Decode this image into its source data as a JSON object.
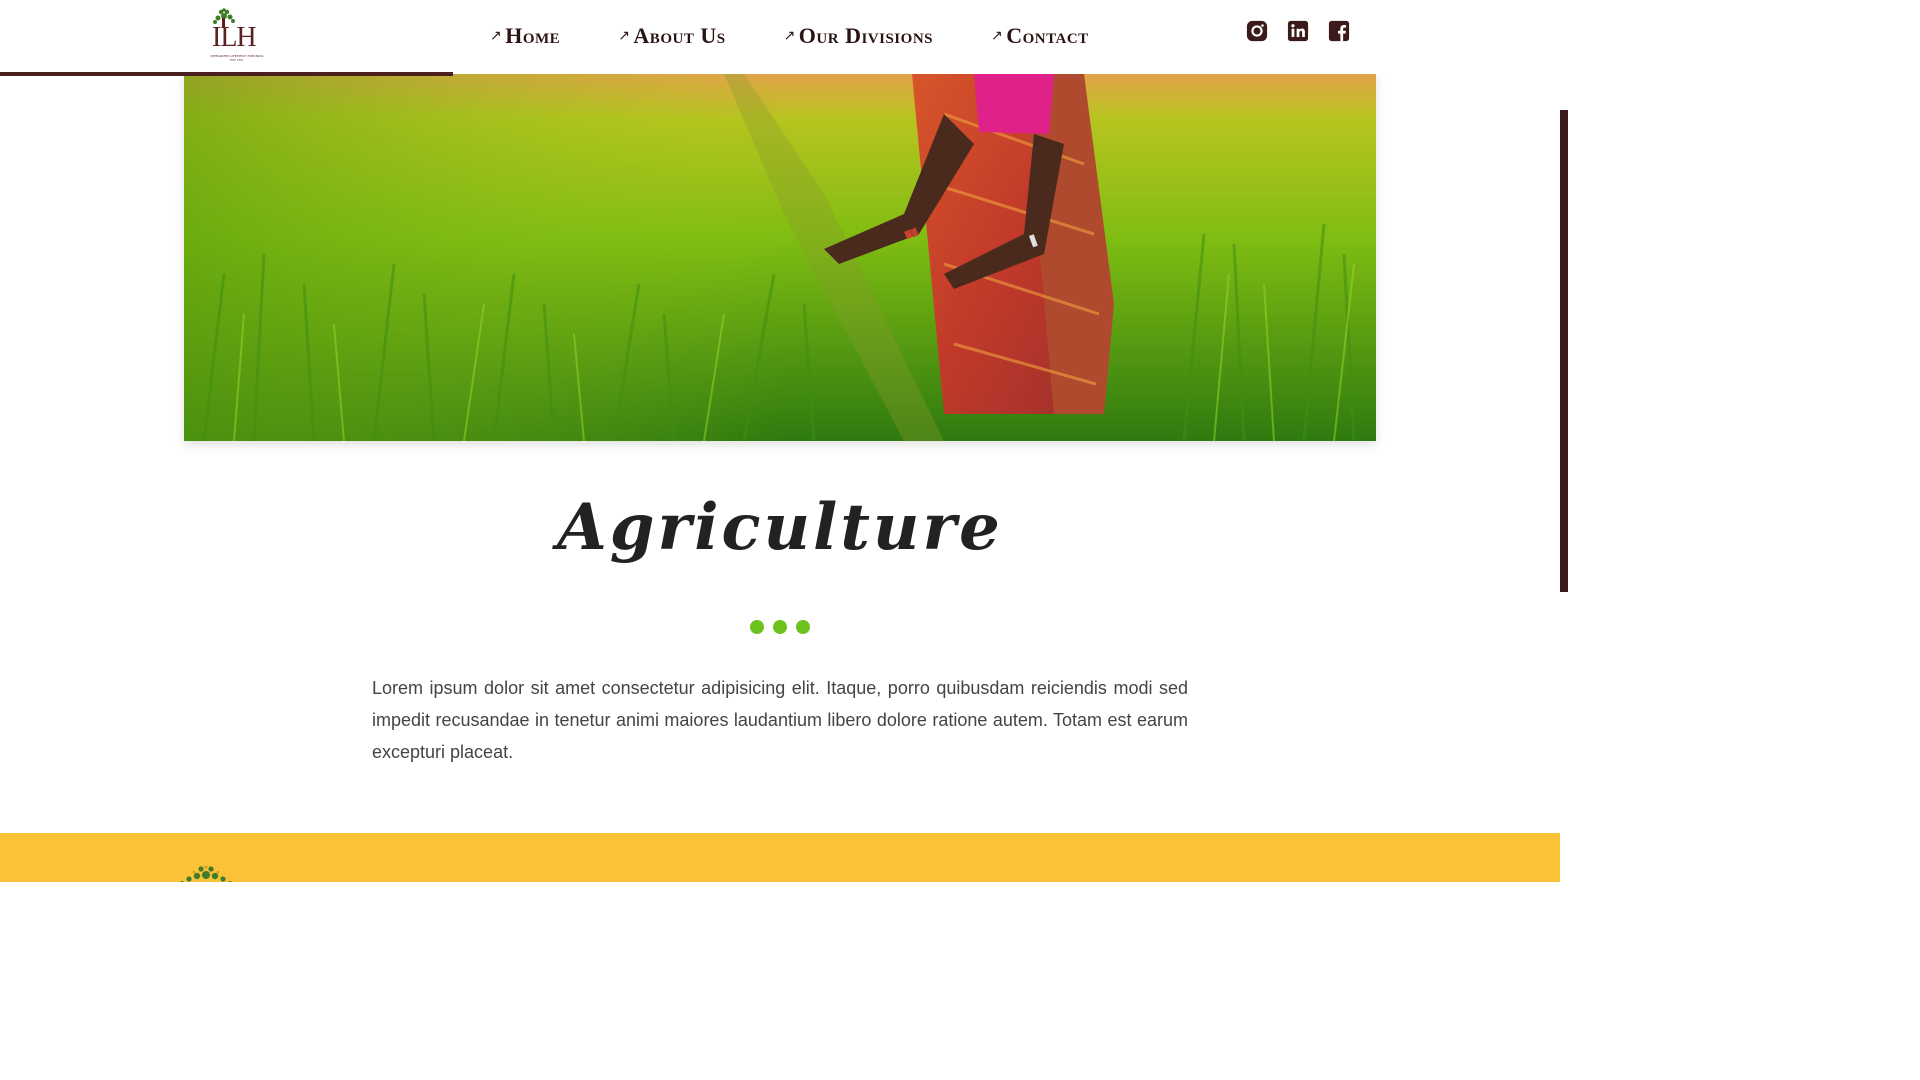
{
  "header": {
    "logo": {
      "text": "ILH",
      "subtitle": "INTEGRATED LIFESTECH HUB INDIA PVT. LTD."
    },
    "nav": [
      {
        "label": "Home"
      },
      {
        "label": "About Us"
      },
      {
        "label": "Our Divisions"
      },
      {
        "label": "Contact"
      }
    ],
    "nav_arrow": "↗",
    "social": [
      "instagram-icon",
      "linkedin-icon",
      "facebook-icon"
    ]
  },
  "hero": {
    "image": "woman-in-rice-field"
  },
  "main": {
    "title": "Agriculture",
    "body": "Lorem ipsum dolor sit amet consectetur adipisicing elit. Itaque, porro quibusdam reiciendis modi sed impedit recusandae in tenetur animi maiores laudantium libero dolore ratione autem. Totam est earum excepturi placeat."
  },
  "colors": {
    "brand": "#4a1f1d",
    "accent_green": "#6cc21c",
    "footer": "#fcc237"
  }
}
